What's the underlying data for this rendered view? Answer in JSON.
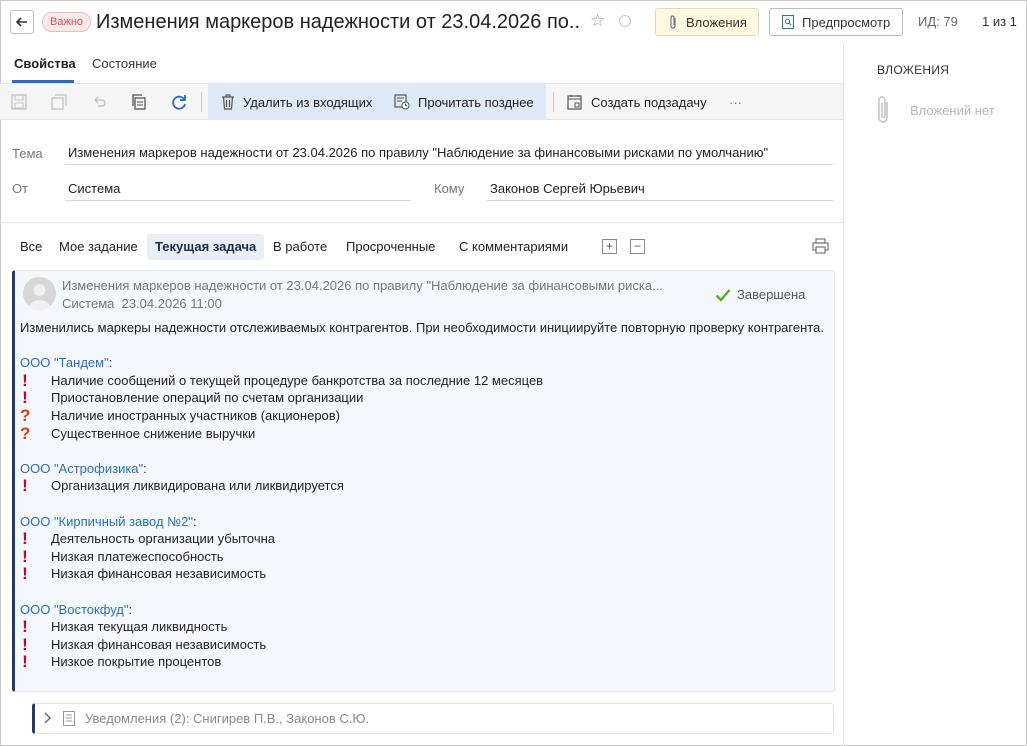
{
  "header": {
    "badge": "Важно",
    "title": "Изменения маркеров надежности от 23.04.2026 по...",
    "attachments_button": "Вложения",
    "preview_button": "Предпросмотр",
    "id_text": "ИД: 79",
    "page_count": "1 из 1"
  },
  "tabs": [
    {
      "label": "Свойства",
      "active": true
    },
    {
      "label": "Состояние",
      "active": false
    }
  ],
  "toolbar": {
    "remove_from_inbox": "Удалить из входящих",
    "read_later": "Прочитать позднее",
    "create_subtask": "Создать подзадачу",
    "more": "···"
  },
  "form": {
    "subject_label": "Тема",
    "subject_value": "Изменения маркеров надежности от 23.04.2026 по правилу \"Наблюдение за финансовыми рисками по умолчанию\"",
    "from_label": "От",
    "from_value": "Система",
    "to_label": "Кому",
    "to_value": "Законов Сергей Юрьевич"
  },
  "filters": [
    {
      "label": "Все",
      "active": false
    },
    {
      "label": "Мое задание",
      "active": false
    },
    {
      "label": "Текущая задача",
      "active": true
    },
    {
      "label": "В работе",
      "active": false
    },
    {
      "label": "Просроченные",
      "active": false
    },
    {
      "label": "С комментариями",
      "active": false
    }
  ],
  "message": {
    "subject": "Изменения маркеров надежности от 23.04.2026 по правилу \"Наблюдение за финансовыми риска...",
    "author": "Система",
    "datetime": "23.04.2026 11:00",
    "status": "Завершена",
    "intro": "Изменились маркеры надежности отслеживаемых контрагентов. При необходимости инициируйте повторную проверку контрагента.",
    "orgs": [
      {
        "name": "ООО \"Тандем\"",
        "items": [
          {
            "mark": "!",
            "text": "Наличие сообщений о текущей процедуре банкротства за последние 12 месяцев"
          },
          {
            "mark": "!",
            "text": "Приостановление операций по счетам организации"
          },
          {
            "mark": "?",
            "text": "Наличие иностранных участников (акционеров)"
          },
          {
            "mark": "?",
            "text": "Существенное снижение выручки"
          }
        ]
      },
      {
        "name": "ООО \"Астрофизика\"",
        "items": [
          {
            "mark": "!",
            "text": "Организация ликвидирована или ликвидируется"
          }
        ]
      },
      {
        "name": "ООО \"Кирпичный завод №2\"",
        "items": [
          {
            "mark": "!",
            "text": "Деятельность организации убыточна"
          },
          {
            "mark": "!",
            "text": "Низкая платежеспособность"
          },
          {
            "mark": "!",
            "text": "Низкая финансовая независимость"
          }
        ]
      },
      {
        "name": "ООО \"Востокфуд\"",
        "items": [
          {
            "mark": "!",
            "text": "Низкая текущая ликвидность"
          },
          {
            "mark": "!",
            "text": "Низкая финансовая независимость"
          },
          {
            "mark": "!",
            "text": "Низкое покрытие процентов"
          }
        ]
      }
    ]
  },
  "notifications": {
    "text": "Уведомления (2): Снигирев П.В., Законов С.Ю."
  },
  "attachments_panel": {
    "title": "ВЛОЖЕНИЯ",
    "empty_text": "Вложений нет"
  },
  "colors": {
    "accent": "#2a6ebb",
    "important": "#d9534f",
    "card_border": "#1e3a66",
    "status_ok": "#5aa822",
    "mark_red": "#d0021b"
  }
}
